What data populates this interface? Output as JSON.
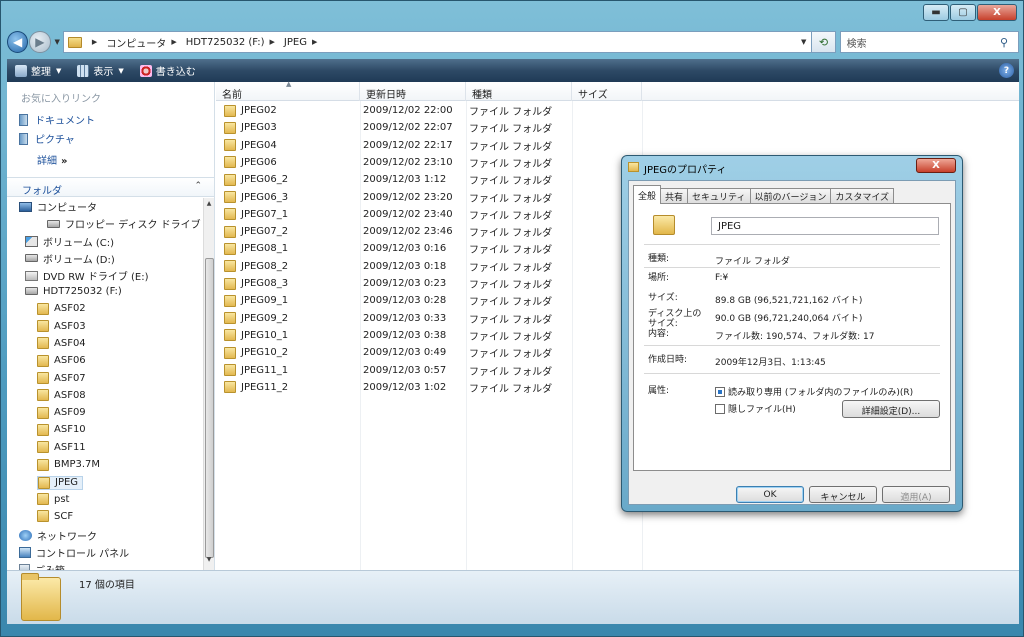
{
  "window": {
    "controls": {
      "minimize": "▬",
      "maximize": "▢",
      "close": "X"
    }
  },
  "address": {
    "crumbs": [
      "コンピュータ",
      "HDT725032 (F:)",
      "JPEG"
    ],
    "search_placeholder": "検索"
  },
  "toolbar": {
    "organize": "整理",
    "views": "表示",
    "burn": "書き込む",
    "help": "?"
  },
  "favorites": {
    "header": "お気に入りリンク",
    "items": [
      "ドキュメント",
      "ピクチャ"
    ],
    "more": "詳細",
    "more_chev": "»"
  },
  "folders": {
    "header": "フォルダ",
    "tree": [
      {
        "label": "コンピュータ",
        "icon": "computer-icon"
      },
      {
        "label": "フロッピー ディスク ドライブ (A:",
        "icon": "floppy-icon"
      },
      {
        "label": "ボリューム (C:)",
        "icon": "drive-c-icon"
      },
      {
        "label": "ボリューム (D:)",
        "icon": "drive-icon"
      },
      {
        "label": "DVD RW ドライブ (E:)",
        "icon": "dvd-icon"
      },
      {
        "label": "HDT725032 (F:)",
        "icon": "drive-icon"
      },
      {
        "label": "ASF02",
        "icon": "folder-icon"
      },
      {
        "label": "ASF03",
        "icon": "folder-icon"
      },
      {
        "label": "ASF04",
        "icon": "folder-icon"
      },
      {
        "label": "ASF06",
        "icon": "folder-icon"
      },
      {
        "label": "ASF07",
        "icon": "folder-icon"
      },
      {
        "label": "ASF08",
        "icon": "folder-icon"
      },
      {
        "label": "ASF09",
        "icon": "folder-icon"
      },
      {
        "label": "ASF10",
        "icon": "folder-icon"
      },
      {
        "label": "ASF11",
        "icon": "folder-icon"
      },
      {
        "label": "BMP3.7M",
        "icon": "folder-icon"
      },
      {
        "label": "JPEG",
        "icon": "folder-icon",
        "selected": true
      },
      {
        "label": "pst",
        "icon": "folder-icon"
      },
      {
        "label": "SCF",
        "icon": "folder-icon"
      },
      {
        "label": "ネットワーク",
        "icon": "network-icon"
      },
      {
        "label": "コントロール パネル",
        "icon": "control-panel-icon"
      },
      {
        "label": "ごみ箱",
        "icon": "recycle-bin-icon"
      }
    ]
  },
  "columns": [
    "名前",
    "更新日時",
    "種類",
    "サイズ"
  ],
  "files": [
    {
      "name": "JPEG02",
      "date": "2009/12/02 22:00",
      "type": "ファイル フォルダ"
    },
    {
      "name": "JPEG03",
      "date": "2009/12/02 22:07",
      "type": "ファイル フォルダ"
    },
    {
      "name": "JPEG04",
      "date": "2009/12/02 22:17",
      "type": "ファイル フォルダ"
    },
    {
      "name": "JPEG06",
      "date": "2009/12/02 23:10",
      "type": "ファイル フォルダ"
    },
    {
      "name": "JPEG06_2",
      "date": "2009/12/03 1:12",
      "type": "ファイル フォルダ"
    },
    {
      "name": "JPEG06_3",
      "date": "2009/12/02 23:20",
      "type": "ファイル フォルダ"
    },
    {
      "name": "JPEG07_1",
      "date": "2009/12/02 23:40",
      "type": "ファイル フォルダ"
    },
    {
      "name": "JPEG07_2",
      "date": "2009/12/02 23:46",
      "type": "ファイル フォルダ"
    },
    {
      "name": "JPEG08_1",
      "date": "2009/12/03 0:16",
      "type": "ファイル フォルダ"
    },
    {
      "name": "JPEG08_2",
      "date": "2009/12/03 0:18",
      "type": "ファイル フォルダ"
    },
    {
      "name": "JPEG08_3",
      "date": "2009/12/03 0:23",
      "type": "ファイル フォルダ"
    },
    {
      "name": "JPEG09_1",
      "date": "2009/12/03 0:28",
      "type": "ファイル フォルダ"
    },
    {
      "name": "JPEG09_2",
      "date": "2009/12/03 0:33",
      "type": "ファイル フォルダ"
    },
    {
      "name": "JPEG10_1",
      "date": "2009/12/03 0:38",
      "type": "ファイル フォルダ"
    },
    {
      "name": "JPEG10_2",
      "date": "2009/12/03 0:49",
      "type": "ファイル フォルダ"
    },
    {
      "name": "JPEG11_1",
      "date": "2009/12/03 0:57",
      "type": "ファイル フォルダ"
    },
    {
      "name": "JPEG11_2",
      "date": "2009/12/03 1:02",
      "type": "ファイル フォルダ"
    }
  ],
  "status": {
    "count": "17 個の項目"
  },
  "dialog": {
    "title": "JPEGのプロパティ",
    "close": "X",
    "tabs": [
      "全般",
      "共有",
      "セキュリティ",
      "以前のバージョン",
      "カスタマイズ"
    ],
    "name": "JPEG",
    "type_label": "種類:",
    "type_value": "ファイル フォルダ",
    "location_label": "場所:",
    "location_value": "F:¥",
    "size_label": "サイズ:",
    "size_value": "89.8 GB (96,521,721,162 バイト)",
    "disk_label": "ディスク上のサイズ:",
    "disk_value": "90.0 GB (96,721,240,064 バイト)",
    "contents_label": "内容:",
    "contents_value": "ファイル数: 190,574、フォルダ数: 17",
    "created_label": "作成日時:",
    "created_value": "2009年12月3日、1:13:45",
    "attributes_label": "属性:",
    "readonly_label": "読み取り専用 (フォルダ内のファイルのみ)(R)",
    "hidden_label": "隠しファイル(H)",
    "advanced_button": "詳細設定(D)...",
    "ok": "OK",
    "cancel": "キャンセル",
    "apply": "適用(A)"
  }
}
